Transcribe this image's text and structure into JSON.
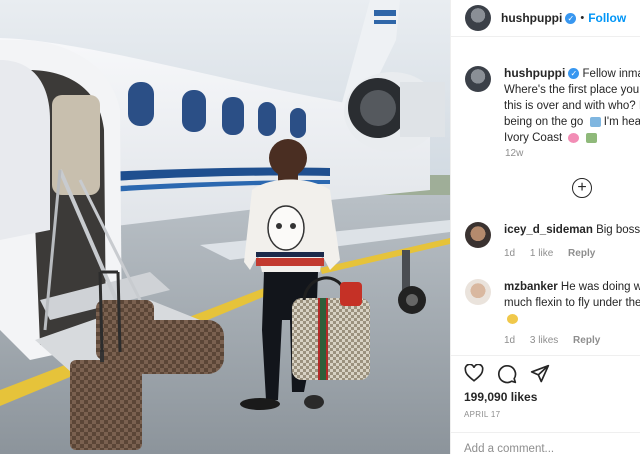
{
  "header": {
    "username": "hushpuppi",
    "follow_label": "Follow",
    "separator": "•"
  },
  "caption": {
    "username": "hushpuppi",
    "lines": [
      "Fellow inmate",
      "Where's the first place you t",
      "this is over and with who? I",
      "being on the go",
      "I'm hea",
      "Ivory Coast"
    ],
    "time": "12w"
  },
  "comments": [
    {
      "username": "icey_d_sideman",
      "text": "Big boss",
      "time": "1d",
      "likes": "1 like",
      "reply": "Reply"
    },
    {
      "username": "mzbanker",
      "text_lines": [
        "He was doing wa",
        "much flexin to fly under the"
      ],
      "time": "1d",
      "likes": "3 likes",
      "reply": "Reply"
    }
  ],
  "post": {
    "likes": "199,090 likes",
    "date": "APRIL 17",
    "add_comment_placeholder": "Add a comment..."
  },
  "icons": [
    "heart-icon",
    "comment-icon",
    "share-icon",
    "plus-circle-icon",
    "verified-badge-icon"
  ],
  "colors": {
    "follow": "#0095f6",
    "verified": "#3897f0",
    "muted": "#8e8e8e",
    "text": "#262626"
  }
}
